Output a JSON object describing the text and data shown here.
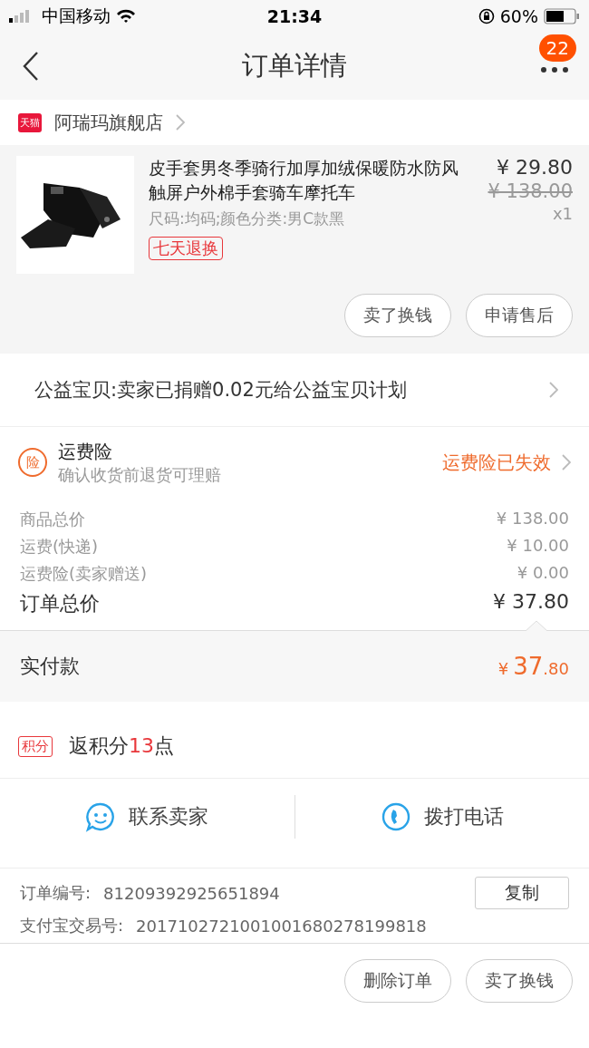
{
  "status_bar": {
    "carrier": "中国移动",
    "time": "21:34",
    "battery": "60%"
  },
  "nav": {
    "title": "订单详情",
    "badge": "22"
  },
  "shop": {
    "logo": "天猫",
    "name": "阿瑞玛旗舰店"
  },
  "product": {
    "title": "皮手套男冬季骑行加厚加绒保暖防水防风触屏户外棉手套骑车摩托车",
    "spec": "尺码:均码;颜色分类:男C款黑",
    "tag": "七天退换",
    "price": "¥ 29.80",
    "original_price": "¥ 138.00",
    "quantity": "x1",
    "buttons": [
      "卖了换钱",
      "申请售后"
    ]
  },
  "charity": {
    "text": "公益宝贝:卖家已捐赠0.02元给公益宝贝计划"
  },
  "insurance": {
    "icon": "险",
    "title": "运费险",
    "subtitle": "确认收货前退货可理赔",
    "status": "运费险已失效"
  },
  "costs": [
    {
      "label": "商品总价",
      "value": "¥ 138.00",
      "kind": "minor"
    },
    {
      "label": "运费(快递)",
      "value": "¥ 10.00",
      "kind": "minor"
    },
    {
      "label": "运费险(卖家赠送)",
      "value": "¥ 0.00",
      "kind": "minor"
    },
    {
      "label": "订单总价",
      "value": "¥ 37.80",
      "kind": "total"
    }
  ],
  "paid": {
    "label": "实付款",
    "currency": "¥",
    "integer": "37",
    "decimal": ".80"
  },
  "points": {
    "tag": "积分",
    "prefix": "返积分",
    "amount": "13",
    "suffix": "点"
  },
  "contact": [
    {
      "label": "联系卖家",
      "kind": "chat"
    },
    {
      "label": "拨打电话",
      "kind": "phone"
    }
  ],
  "order_info": [
    {
      "label": "订单编号:",
      "value": "81209392925651894",
      "action": "复制"
    },
    {
      "label": "支付宝交易号:",
      "value": "2017102721001001680278199818"
    }
  ],
  "bottom_buttons": [
    "删除订单",
    "卖了换钱"
  ]
}
